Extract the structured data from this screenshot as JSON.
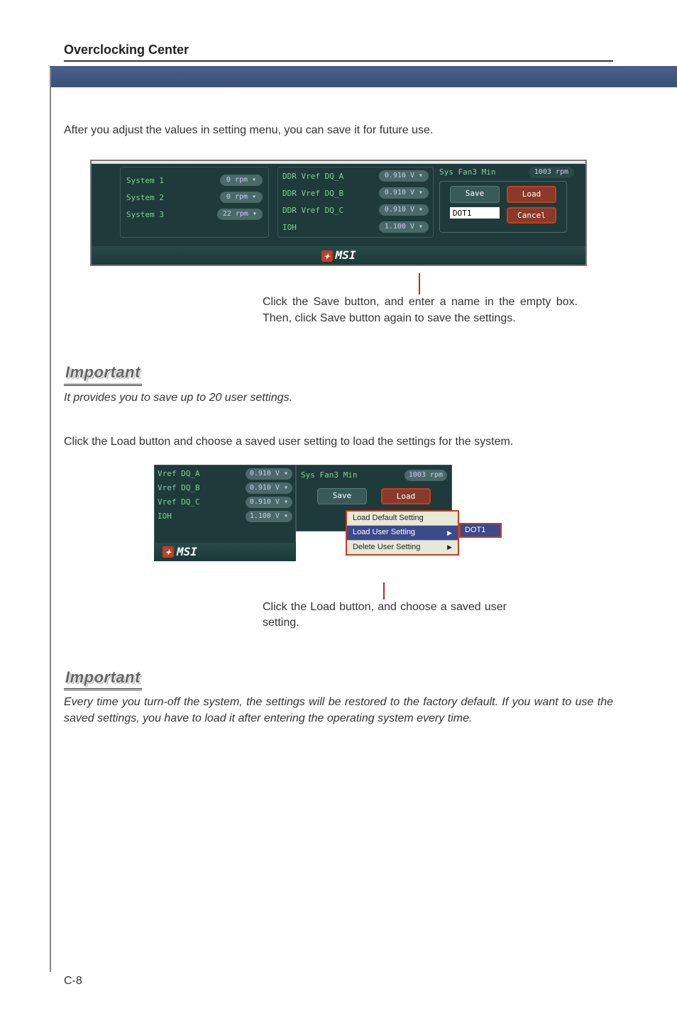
{
  "header": {
    "title": "Overclocking Center"
  },
  "intro": "After you adjust the values in setting menu, you can save it for future use.",
  "shot1": {
    "col1": [
      {
        "label": "System 1",
        "value": "0 rpm ▾"
      },
      {
        "label": "System 2",
        "value": "0 rpm ▾"
      },
      {
        "label": "System 3",
        "value": "22 rpm ▾"
      }
    ],
    "col2": [
      {
        "label": "DDR Vref DQ_A",
        "value": "0.910 V ▾"
      },
      {
        "label": "DDR Vref DQ_B",
        "value": "0.910 V ▾"
      },
      {
        "label": "DDR Vref DQ_C",
        "value": "0.910 V ▾"
      },
      {
        "label": "IOH",
        "value": "1.100 V ▾"
      }
    ],
    "sysfan_label": "Sys Fan3 Min",
    "sysfan_value": "1003 rpm",
    "save": "Save",
    "load": "Load",
    "cancel": "Cancel",
    "input_value": "DOT1",
    "logo": "MSI"
  },
  "instruction1": "Click the Save button, and enter a name in the empty box. Then, click Save button again to save the settings.",
  "important1_head": "Important",
  "important1_body": "It provides you to save up to 20 user settings.",
  "load_intro": "Click the Load button and choose a saved user setting to load the settings for the system.",
  "shot2": {
    "left": [
      {
        "label": "Vref DQ_A",
        "value": "0.910 V ▾"
      },
      {
        "label": "Vref DQ_B",
        "value": "0.910 V ▾"
      },
      {
        "label": "Vref DQ_C",
        "value": "0.910 V ▾"
      },
      {
        "label": "IOH",
        "value": "1.100 V ▾"
      }
    ],
    "sysfan_label": "Sys Fan3 Min",
    "sysfan_value": "1003 rpm",
    "save": "Save",
    "load": "Load",
    "menu": [
      {
        "label": "Load Default Setting"
      },
      {
        "label": "Load User Setting",
        "sub": true
      },
      {
        "label": "Delete User Setting",
        "sub": true
      }
    ],
    "submenu_label": "DOT1",
    "logo": "MSI"
  },
  "instruction2": "Click the Load button, and choose a saved user setting.",
  "important2_head": "Important",
  "important2_body": "Every time you turn-off the system, the settings will be restored to the factory default. If you want to use the saved settings, you have to load it after entering the operating system every time.",
  "footer": "C-8"
}
